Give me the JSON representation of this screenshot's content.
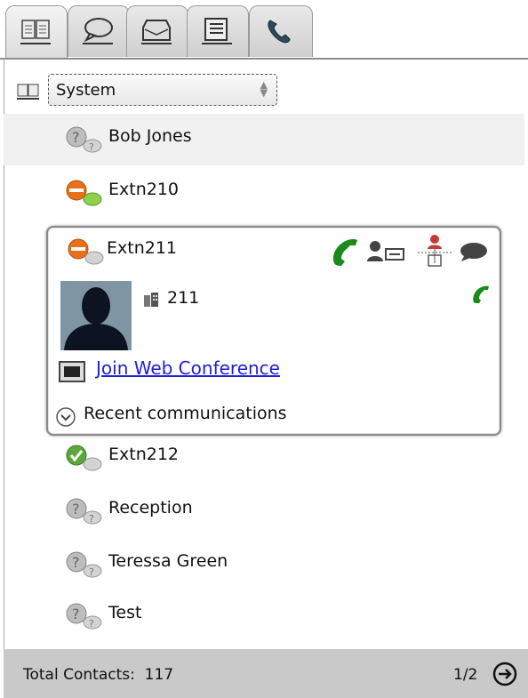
{
  "tabs": [
    {
      "icon": "directory-book-icon",
      "active": true
    },
    {
      "icon": "chat-bubble-icon",
      "active": false
    },
    {
      "icon": "voicemail-tray-icon",
      "active": false
    },
    {
      "icon": "call-list-icon",
      "active": false
    },
    {
      "icon": "phone-handset-icon",
      "active": false
    }
  ],
  "filter": {
    "selected": "System",
    "icon": "directory-book-icon"
  },
  "contacts": [
    {
      "name": "Bob Jones",
      "status": "unknown"
    },
    {
      "name": "Extn210",
      "status": "busy-available-chat"
    },
    {
      "name": "Extn211",
      "status": "busy",
      "expanded": true
    },
    {
      "name": "Extn212",
      "status": "available"
    },
    {
      "name": "Reception",
      "status": "unknown"
    },
    {
      "name": "Teressa Green",
      "status": "unknown"
    },
    {
      "name": "Test",
      "status": "unknown"
    }
  ],
  "card": {
    "extension": "211",
    "web_conference_label": "Join Web Conference",
    "recent_label": "Recent communications"
  },
  "footer": {
    "total_label": "Total Contacts:  117",
    "page_label": "1/2"
  },
  "colors": {
    "phone_green": "#1a8a1a",
    "busy_orange": "#e8701a",
    "link_blue": "#1f1fd6",
    "footer_bg": "#c9c9c9"
  }
}
